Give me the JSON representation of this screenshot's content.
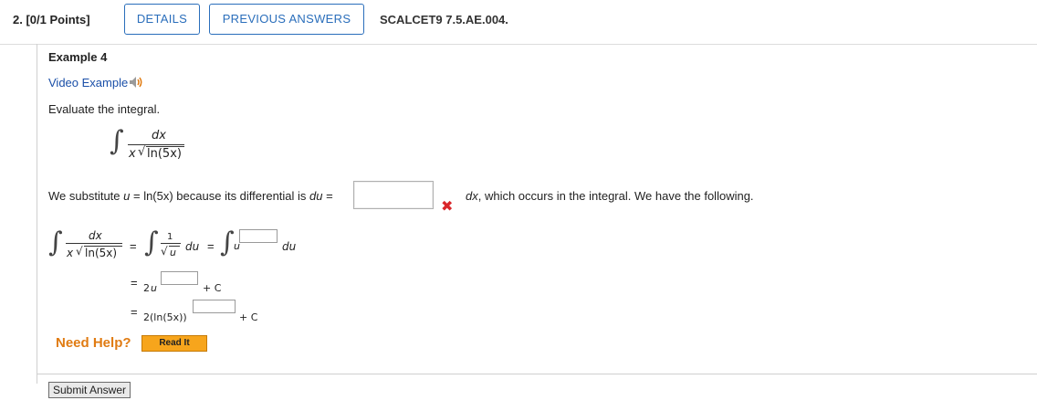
{
  "header": {
    "question_number": "2. [0/1 Points]",
    "details_label": "DETAILS",
    "previous_answers_label": "PREVIOUS ANSWERS",
    "problem_code": "SCALCET9 7.5.AE.004."
  },
  "example": {
    "title": "Example 4",
    "video_link": "Video Example",
    "instruction": "Evaluate the integral."
  },
  "integral": {
    "numerator": "dx",
    "denominator_x": "x",
    "denominator_radicand": "ln(5x)"
  },
  "substitution": {
    "prefix": "We substitute ",
    "var_u": "u",
    "middle": " = ln(5x) because its differential is ",
    "du": "du",
    "equals": " =",
    "answer_value": "",
    "suffix_dx": "dx",
    "suffix_rest": ", which occurs in the integral. We have the following."
  },
  "steps": {
    "lhs_num": "dx",
    "lhs_den_x": "x",
    "lhs_den_rad": "ln(5x)",
    "eq": "=",
    "one": "1",
    "u": "u",
    "du": "du",
    "eq2": "=",
    "u_base": "u",
    "du2": "du",
    "eq3": "=",
    "line2_coeff": "2",
    "line2_u": "u",
    "plus_c": "+ C",
    "eq4": "=",
    "line3_expr": "2(ln(5x))",
    "plus_c2": "+ C"
  },
  "help": {
    "need_help": "Need Help?",
    "read_it": "Read It"
  },
  "submit_label": "Submit Answer",
  "colors": {
    "link_blue": "#2a6ebb",
    "error_red": "#d9262a",
    "help_orange": "#e07b12",
    "read_it_bg": "#f7a51c"
  }
}
